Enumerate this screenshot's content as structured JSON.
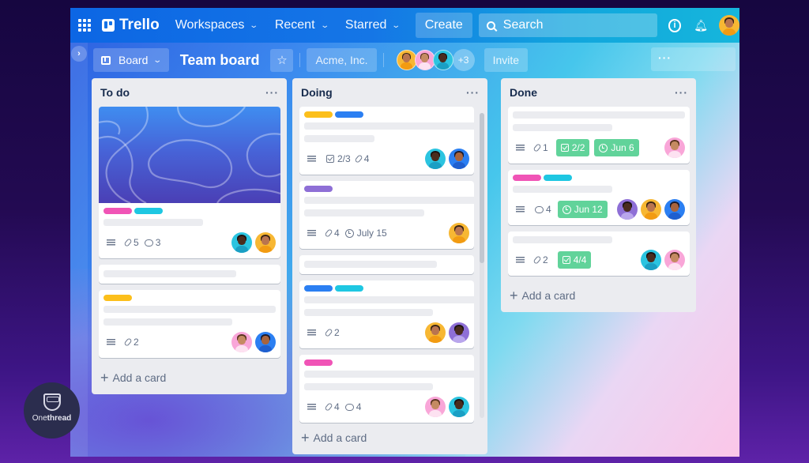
{
  "topnav": {
    "apps_icon": "grid-icon",
    "logo": "Trello",
    "menus": [
      {
        "label": "Workspaces"
      },
      {
        "label": "Recent"
      },
      {
        "label": "Starred"
      }
    ],
    "create_label": "Create",
    "search_placeholder": "Search",
    "info_icon": "info-icon",
    "notifications_icon": "bell-icon"
  },
  "boardbar": {
    "sidebar_toggle": "›",
    "view_label": "Board",
    "title": "Team board",
    "star_icon": "☆",
    "workspace": "Acme, Inc.",
    "extra_members": "+3",
    "invite_label": "Invite",
    "menu_label": "···"
  },
  "colors": {
    "label_pink": "#f054b6",
    "label_cyan": "#1ec7e2",
    "label_yellow": "#fcbf1b",
    "label_blue": "#2b7ff2",
    "label_purple": "#8e6fd6",
    "due_complete_green": "#61d39a"
  },
  "lists": [
    {
      "title": "To do",
      "menu": "···",
      "add_card": "Add a card",
      "cards": [
        {
          "labels": [
            "pink",
            "cyan"
          ],
          "desc": true,
          "attachments": "5",
          "comments": "3",
          "members": [
            "teal-woman",
            "yellow-woman"
          ]
        },
        {},
        {
          "labels": [
            "yellow"
          ],
          "desc": true,
          "attachments": "2",
          "members": [
            "pink-man",
            "blue-man"
          ]
        }
      ]
    },
    {
      "title": "Doing",
      "menu": "···",
      "add_card": "Add a card",
      "cards": [
        {
          "labels": [
            "yellow",
            "blue"
          ],
          "desc": true,
          "checklist": "2/3",
          "attachments": "4",
          "members": [
            "teal-woman",
            "blue-man"
          ]
        },
        {
          "labels": [
            "purple"
          ],
          "desc": true,
          "attachments": "4",
          "due": "July 15",
          "members": [
            "yellow-woman"
          ]
        },
        {},
        {
          "labels": [
            "blue",
            "cyan"
          ],
          "desc": true,
          "attachments": "2",
          "members": [
            "yellow-woman",
            "purple-man"
          ]
        },
        {
          "labels": [
            "pink"
          ],
          "desc": true,
          "attachments": "4",
          "comments": "4",
          "members": [
            "pink-man",
            "teal-woman"
          ]
        }
      ]
    },
    {
      "title": "Done",
      "menu": "···",
      "add_card": "Add a card",
      "cards": [
        {
          "desc": true,
          "attachments": "1",
          "checklist": "2/2",
          "due": "Jun 6",
          "members": [
            "pink-man"
          ]
        },
        {
          "labels": [
            "pink",
            "cyan"
          ],
          "desc": true,
          "comments": "4",
          "due": "Jun 12",
          "members": [
            "purple-man",
            "yellow-woman",
            "blue-man"
          ]
        },
        {
          "desc": true,
          "attachments": "2",
          "checklist": "4/4",
          "members": [
            "teal-woman",
            "pink-man"
          ]
        }
      ]
    }
  ],
  "watermark": {
    "brand_light": "One",
    "brand_bold": "thread"
  }
}
